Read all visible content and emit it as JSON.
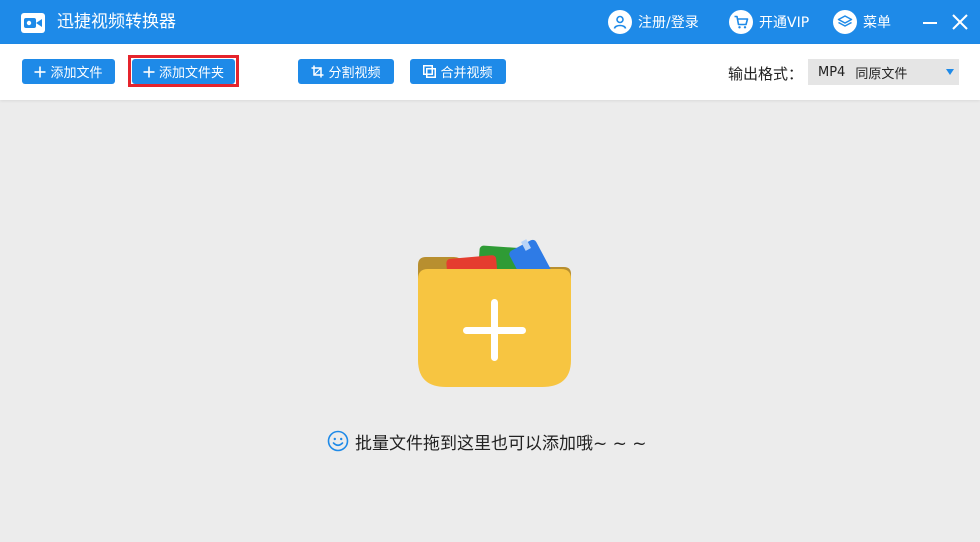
{
  "app": {
    "title": "迅捷视频转换器",
    "accent_color": "#1e8ae8",
    "highlight_color": "#e5242c"
  },
  "titlebar": {
    "login_label": "注册/登录",
    "vip_label": "开通VIP",
    "menu_label": "菜单"
  },
  "toolbar": {
    "add_file_label": "添加文件",
    "add_folder_label": "添加文件夹",
    "split_label": "分割视频",
    "merge_label": "合并视频",
    "output_format_label": "输出格式：",
    "output_format_value": "MP4",
    "output_quality_value": "同原文件"
  },
  "main": {
    "drop_hint": "批量文件拖到这里也可以添加哦~ ~ ~"
  },
  "icons": {
    "logo": "video-camera-icon",
    "login": "user-icon",
    "vip": "cart-icon",
    "menu": "layers-icon",
    "minimize": "minimize-icon",
    "close": "close-icon",
    "add": "plus-icon",
    "split": "crop-icon",
    "merge": "merge-icon",
    "folder": "folder-add-icon",
    "smile": "smile-icon"
  }
}
